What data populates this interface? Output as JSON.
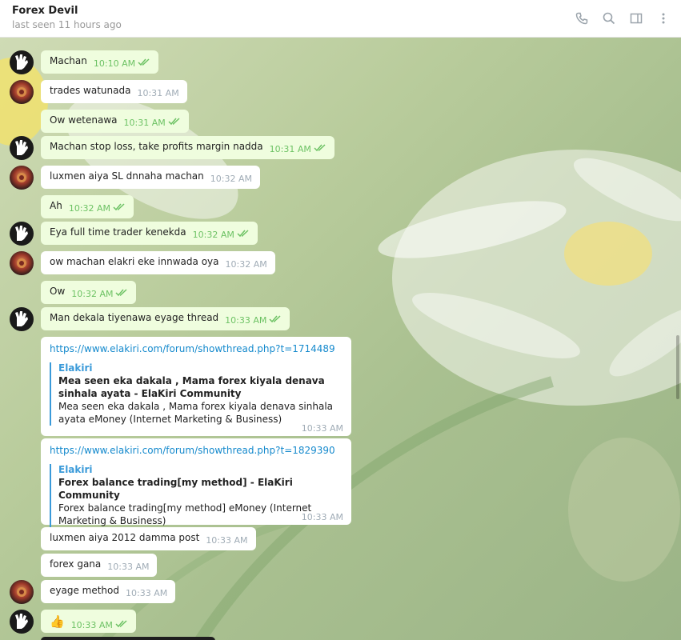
{
  "header": {
    "title": "Forex Devil",
    "status": "last seen 11 hours ago"
  },
  "messages": [
    {
      "text": "Machan",
      "time": "10:10 AM"
    },
    {
      "text": "trades watunada",
      "time": "10:31 AM"
    },
    {
      "text": "Ow wetenawa",
      "time": "10:31 AM"
    },
    {
      "text": "Machan stop loss, take profits margin nadda",
      "time": "10:31 AM"
    },
    {
      "text": "luxmen aiya SL dnnaha machan",
      "time": "10:32 AM"
    },
    {
      "text": "Ah",
      "time": "10:32 AM"
    },
    {
      "text": "Eya full time trader kenekda",
      "time": "10:32 AM"
    },
    {
      "text": "ow machan elakri eke innwada oya",
      "time": "10:32 AM"
    },
    {
      "text": "Ow",
      "time": "10:32 AM"
    },
    {
      "text": "Man dekala tiyenawa eyage thread",
      "time": "10:33 AM"
    },
    {
      "text": "luxmen aiya 2012 damma post",
      "time": "10:33 AM"
    },
    {
      "text": "forex gana",
      "time": "10:33 AM"
    },
    {
      "text": "eyage method",
      "time": "10:33 AM"
    },
    {
      "text": "👍",
      "time": "10:33 AM"
    }
  ],
  "links": [
    {
      "url": "https://www.elakiri.com/forum/showthread.php?t=1714489",
      "site": "Elakiri",
      "title": "Mea seen eka dakala , Mama forex kiyala denava sinhala ayata - ElaKiri Community",
      "desc": "Mea seen eka dakala , Mama forex kiyala denava sinhala ayata eMoney (Internet Marketing & Business)",
      "time": "10:33 AM"
    },
    {
      "url": "https://www.elakiri.com/forum/showthread.php?t=1829390",
      "site": "Elakiri",
      "title": "Forex balance trading[my method] - ElaKiri Community",
      "desc": "Forex balance trading[my method] eMoney (Internet Marketing & Business)",
      "time": "10:33 AM"
    }
  ],
  "icons": {
    "phone": "phone-icon",
    "search": "search-icon",
    "sidebar": "sidebar-toggle-icon",
    "more": "more-vertical-icon"
  },
  "colors": {
    "outgoing_bubble": "#effdde",
    "incoming_bubble": "#ffffff",
    "read_ticks": "#6dc264",
    "link": "#168acd"
  }
}
